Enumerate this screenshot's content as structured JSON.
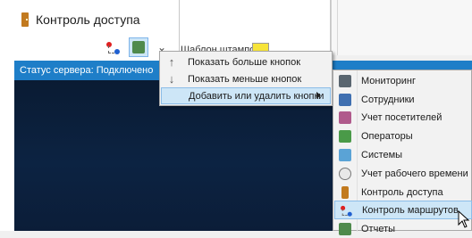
{
  "nav": {
    "item_label": "Контроль доступа"
  },
  "template": {
    "label": "Шаблон штампов"
  },
  "status_bar": {
    "text": "Статус сервера: Подключено"
  },
  "context_menu": {
    "items": [
      {
        "icon": "arrow-up-icon",
        "label": "Показать больше кнопок"
      },
      {
        "icon": "arrow-down-icon",
        "label": "Показать меньше кнопок"
      },
      {
        "icon": "none",
        "label": "Добавить или удалить кнопки"
      }
    ]
  },
  "submenu": {
    "items": [
      {
        "icon": "monitoring-icon",
        "label": "Мониторинг"
      },
      {
        "icon": "employees-icon",
        "label": "Сотрудники"
      },
      {
        "icon": "visitors-icon",
        "label": "Учет посетителей"
      },
      {
        "icon": "operators-icon",
        "label": "Операторы"
      },
      {
        "icon": "systems-icon",
        "label": "Системы"
      },
      {
        "icon": "clock-icon",
        "label": "Учет рабочего времени"
      },
      {
        "icon": "door-icon",
        "label": "Контроль доступа"
      },
      {
        "icon": "route-icon",
        "label": "Контроль маршрутов"
      },
      {
        "icon": "reports-icon",
        "label": "Отчеты"
      }
    ],
    "highlighted_index": 7
  },
  "colors": {
    "status_bar": "#1e7ec8",
    "highlight": "#cde6f7",
    "dark_bg": "#0c2342",
    "swatch": "#f7e43a"
  }
}
